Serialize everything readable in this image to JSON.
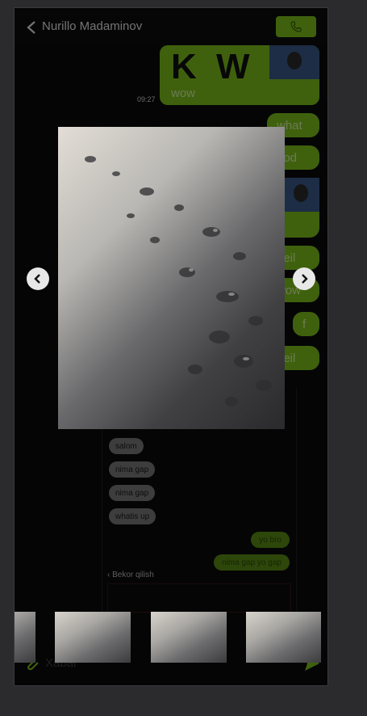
{
  "header": {
    "contact_name": "Nurillo Madaminov"
  },
  "messages": {
    "image_message": {
      "overlay_text": "K W",
      "caption": "wow",
      "time": "09:27"
    },
    "bubbles": [
      "what",
      "ood",
      "heil",
      "wow",
      "f",
      "heil"
    ]
  },
  "reply_panel": {
    "incoming": [
      "salom",
      "nima gap",
      "nima gap",
      "whatis up"
    ],
    "outgoing": [
      "yo bro",
      "nima gap yo gap"
    ],
    "cancel_edit_label": "Bekor qilish"
  },
  "composer": {
    "placeholder": "Xabar"
  },
  "viewer": {
    "thumbnail_count": 4
  },
  "colors": {
    "accent": "#7ec21a",
    "background": "#0b0b0c"
  },
  "icons": [
    "back-arrow-icon",
    "phone-icon",
    "chevron-left-icon",
    "chevron-right-icon",
    "paperclip-icon",
    "send-icon"
  ]
}
